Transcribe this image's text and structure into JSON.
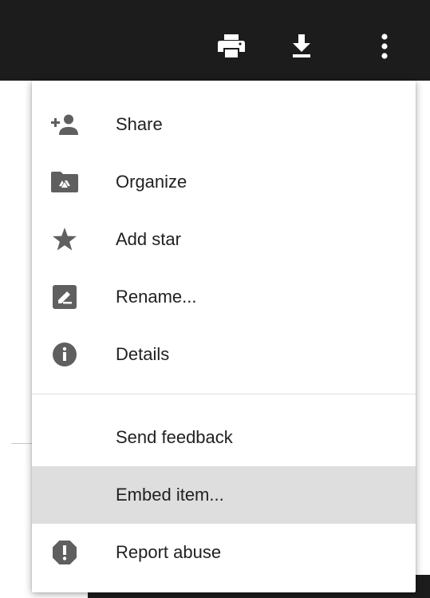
{
  "toolbar": {
    "icons": [
      "print-icon",
      "download-icon",
      "more-vert-icon"
    ]
  },
  "menu": {
    "items": [
      {
        "label": "Share",
        "icon": "person-add-icon"
      },
      {
        "label": "Organize",
        "icon": "drive-folder-icon"
      },
      {
        "label": "Add star",
        "icon": "star-icon"
      },
      {
        "label": "Rename...",
        "icon": "rename-icon"
      },
      {
        "label": "Details",
        "icon": "info-icon"
      }
    ],
    "secondary": [
      {
        "label": "Send feedback"
      },
      {
        "label": "Embed item..."
      },
      {
        "label": "Report abuse",
        "icon": "report-icon"
      }
    ],
    "highlighted_item": "Embed item..."
  },
  "colors": {
    "topbar": "#1c1c1c",
    "icon": "#5f5f5f",
    "text": "#212121",
    "highlight": "#dedede"
  }
}
